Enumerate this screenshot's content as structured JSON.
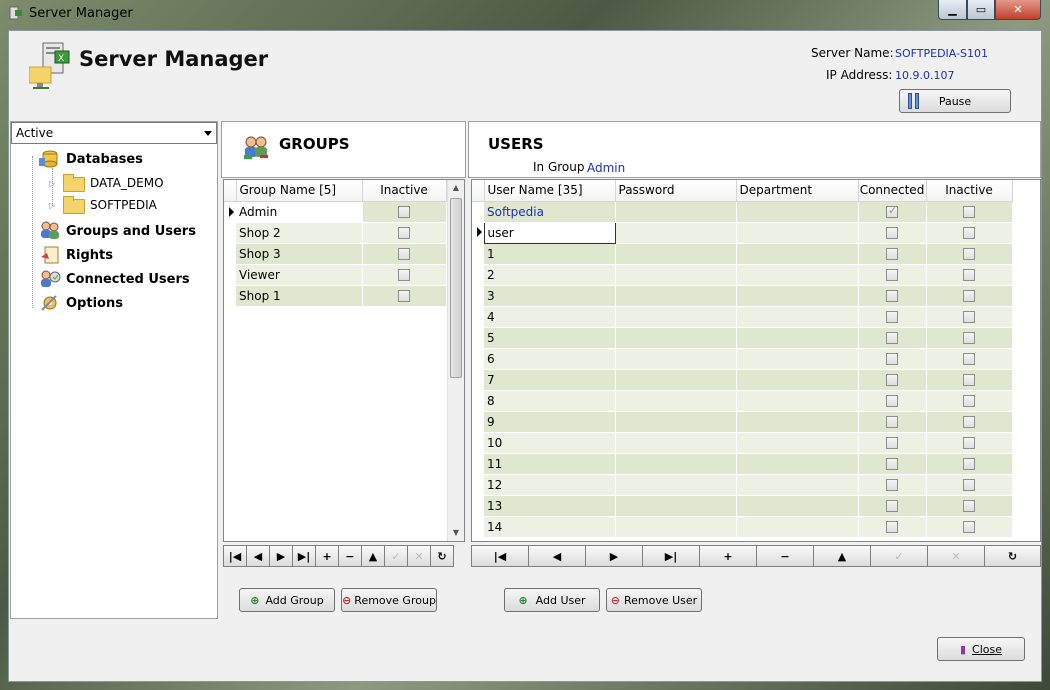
{
  "window": {
    "title": "Server Manager"
  },
  "header": {
    "title": "Server Manager",
    "server_name_label": "Server Name:",
    "server_name_value": "SOFTPEDIA-S101",
    "ip_label": "IP Address:",
    "ip_value": "10.9.0.107",
    "pause_label": "Pause"
  },
  "left": {
    "filter_value": "Active",
    "tree": {
      "databases": "Databases",
      "db_items": [
        "DATA_DEMO",
        "SOFTPEDIA"
      ],
      "groups_users": "Groups and Users",
      "rights": "Rights",
      "connected_users": "Connected Users",
      "options": "Options"
    }
  },
  "groups": {
    "title": "GROUPS",
    "columns": [
      "Group Name [5]",
      "Inactive"
    ],
    "rows": [
      {
        "name": "Admin",
        "inactive": false
      },
      {
        "name": "Shop 2",
        "inactive": false
      },
      {
        "name": "Shop 3",
        "inactive": false
      },
      {
        "name": "Viewer",
        "inactive": false
      },
      {
        "name": "Shop 1",
        "inactive": false
      }
    ],
    "add_label": "Add Group",
    "remove_label": "Remove Group"
  },
  "users": {
    "title": "USERS",
    "in_group_label": "In Group",
    "in_group_value": "Admin",
    "columns": [
      "User Name [35]",
      "Password",
      "Department",
      "Connected",
      "Inactive"
    ],
    "rows": [
      {
        "name": "Softpedia",
        "connected": true,
        "inactive": false
      },
      {
        "name": "user",
        "connected": false,
        "inactive": false
      },
      {
        "name": "1",
        "connected": false,
        "inactive": false
      },
      {
        "name": "2",
        "connected": false,
        "inactive": false
      },
      {
        "name": "3",
        "connected": false,
        "inactive": false
      },
      {
        "name": "4",
        "connected": false,
        "inactive": false
      },
      {
        "name": "5",
        "connected": false,
        "inactive": false
      },
      {
        "name": "6",
        "connected": false,
        "inactive": false
      },
      {
        "name": "7",
        "connected": false,
        "inactive": false
      },
      {
        "name": "8",
        "connected": false,
        "inactive": false
      },
      {
        "name": "9",
        "connected": false,
        "inactive": false
      },
      {
        "name": "10",
        "connected": false,
        "inactive": false
      },
      {
        "name": "11",
        "connected": false,
        "inactive": false
      },
      {
        "name": "12",
        "connected": false,
        "inactive": false
      },
      {
        "name": "13",
        "connected": false,
        "inactive": false
      },
      {
        "name": "14",
        "connected": false,
        "inactive": false
      }
    ],
    "add_label": "Add User",
    "remove_label": "Remove User"
  },
  "footer": {
    "close_label": "Close"
  },
  "navigator": {
    "first": "first-record-icon",
    "prior": "prior-record-icon",
    "next": "next-record-icon",
    "last": "last-record-icon",
    "insert": "insert-record-icon",
    "delete": "delete-record-icon",
    "edit": "edit-record-icon",
    "post": "post-record-icon",
    "cancel": "cancel-record-icon",
    "refresh": "refresh-icon"
  }
}
